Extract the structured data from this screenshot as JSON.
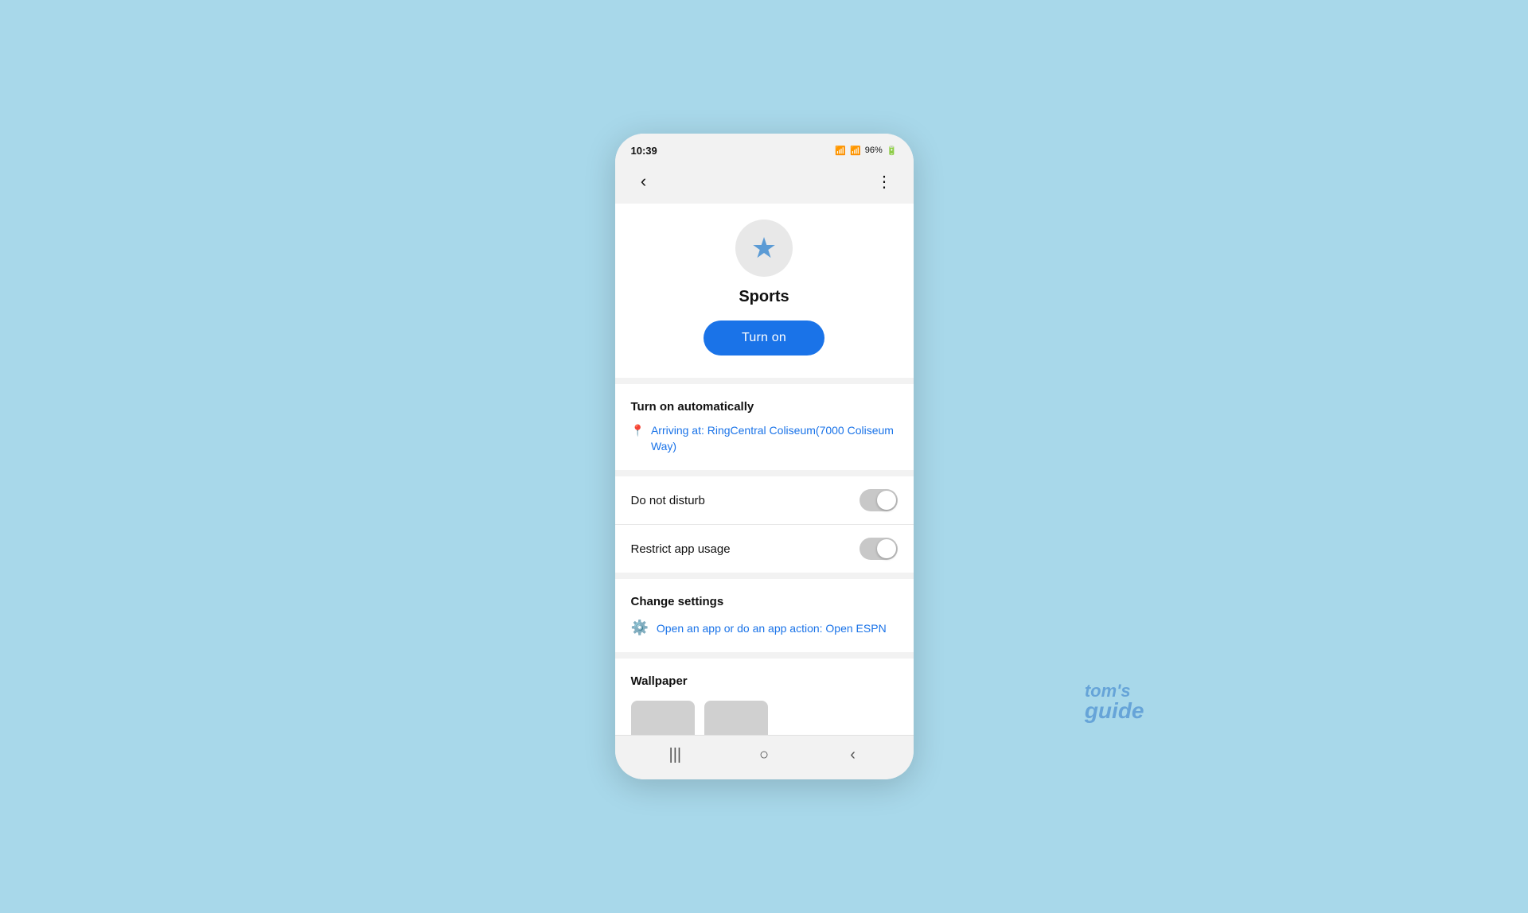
{
  "statusBar": {
    "time": "10:39",
    "battery": "96%",
    "icons": "📷 M ☁ •"
  },
  "topNav": {
    "backLabel": "‹",
    "moreLabel": "⋮"
  },
  "profile": {
    "name": "Sports",
    "turnOnLabel": "Turn on"
  },
  "turnOnAutomatically": {
    "title": "Turn on automatically",
    "locationText": "Arriving at: RingCentral Coliseum(7000 Coliseum Way)"
  },
  "doNotDisturb": {
    "label": "Do not disturb"
  },
  "restrictAppUsage": {
    "label": "Restrict app usage"
  },
  "changeSettings": {
    "title": "Change settings",
    "actionText": "Open an app or do an app action: Open ESPN"
  },
  "wallpaper": {
    "title": "Wallpaper"
  },
  "bottomNav": {
    "recentsIcon": "|||",
    "homeIcon": "○",
    "backIcon": "‹"
  },
  "watermark": {
    "line1": "tom's",
    "line2": "guide"
  }
}
